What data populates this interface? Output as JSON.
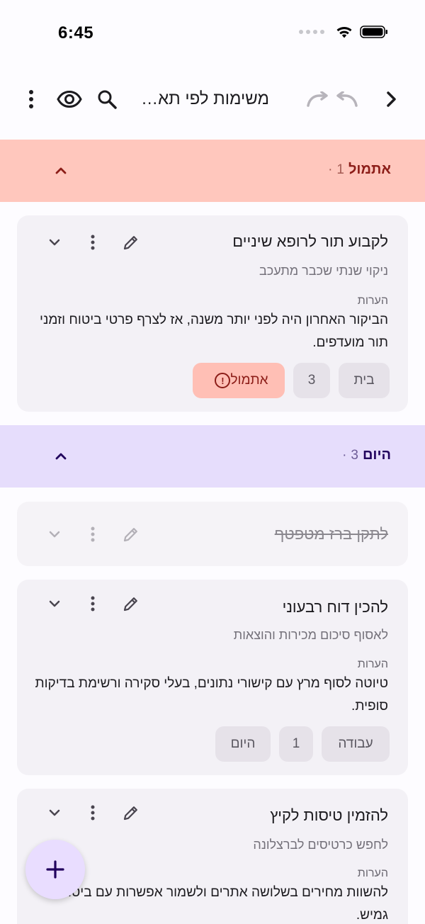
{
  "status": {
    "time": "6:45"
  },
  "toolbar": {
    "title": "משימות לפי תאריך",
    "icons": [
      "more-vert-icon",
      "eye-icon",
      "search-icon",
      "redo-icon",
      "undo-icon",
      "chevron-right-icon"
    ]
  },
  "sections": {
    "overdue": {
      "label": "אתמול",
      "count": "1",
      "dot": "·"
    },
    "today": {
      "label": "היום",
      "count": "3",
      "dot": "·"
    }
  },
  "tasks": [
    {
      "title": "לקבוע תור לרופא שיניים",
      "subtitle": "ניקוי שנתי שכבר מתעכב",
      "notes_label": "הערות",
      "notes": "הביקור האחרון היה לפני יותר משנה, אז לצרף פרטי ביטוח וזמני תור מועדפים.",
      "chips": [
        "בית",
        "3",
        "אתמול"
      ]
    },
    {
      "title": "לתקן ברז מטפטף",
      "completed": true
    },
    {
      "title": "להכין דוח רבעוני",
      "subtitle": "לאסוף סיכום מכירות והוצאות",
      "notes_label": "הערות",
      "notes": "טיוטה לסוף מרץ עם קישורי נתונים, בעלי סקירה ורשימת בדיקות סופית.",
      "chips": [
        "עבודה",
        "1",
        "היום"
      ]
    },
    {
      "title": "להזמין טיסות לקיץ",
      "subtitle": "לחפש כרטיסים לברצלונה",
      "notes_label": "הערות",
      "notes": "להשוות מחירים בשלושה אתרים ולשמור אפשרות עם ביטול גמיש."
    }
  ],
  "colors": {
    "overdue_bg": "#ffc7bd",
    "overdue_text": "#8c1d18",
    "today_bg": "#e6ddfc",
    "today_text": "#21005d",
    "card_bg": "#f3f1f6",
    "fab_bg": "#e9ddff"
  },
  "fab": {
    "icon": "plus-icon"
  }
}
